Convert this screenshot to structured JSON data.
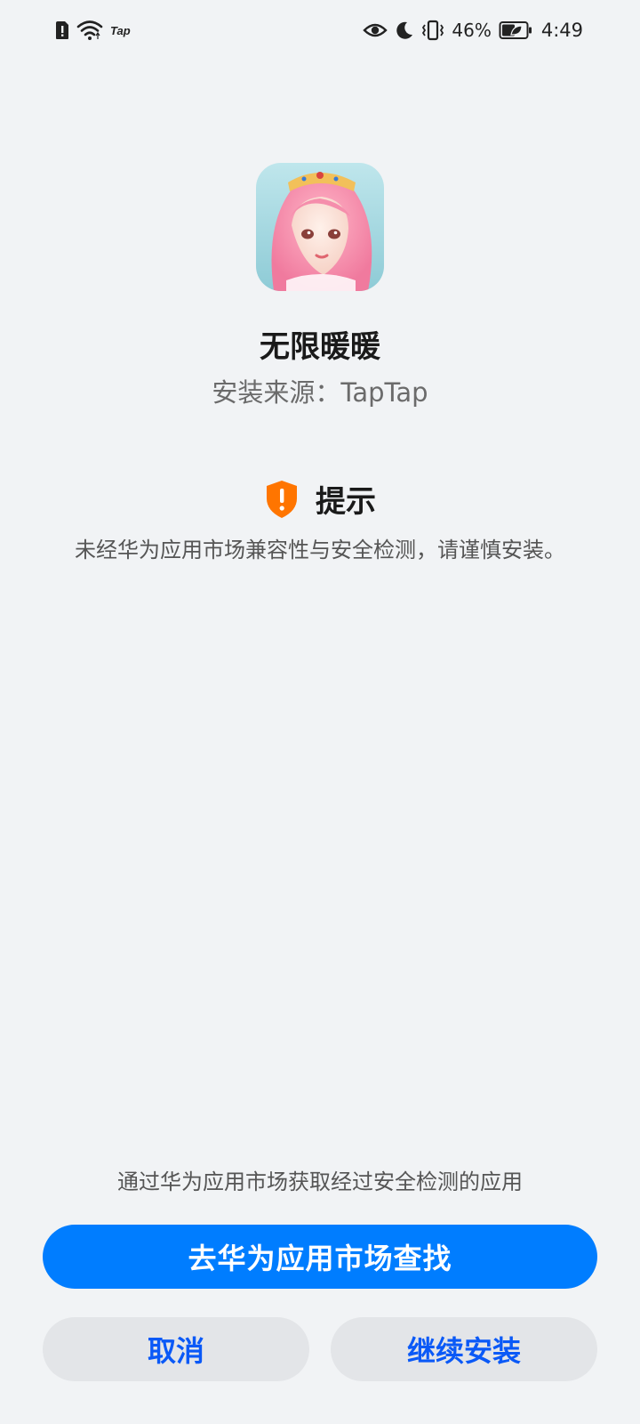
{
  "status_bar": {
    "left_icons": [
      "sim-alert-icon",
      "wifi-icon",
      "taptap-notification-icon"
    ],
    "tap_label": "Tap",
    "right_icons": [
      "eye-comfort-icon",
      "do-not-disturb-moon-icon",
      "vibrate-icon",
      "battery-saver-icon"
    ],
    "battery_percent": "46%",
    "time": "4:49"
  },
  "app": {
    "name": "无限暖暖",
    "install_source": "安装来源：TapTap"
  },
  "warning": {
    "title": "提示",
    "message": "未经华为应用市场兼容性与安全检测，请谨慎安装。",
    "icon": "shield-exclamation-icon",
    "icon_color": "#ff7500"
  },
  "bottom": {
    "market_hint": "通过华为应用市场获取经过安全检测的应用",
    "primary_button": "去华为应用市场查找",
    "cancel_button": "取消",
    "continue_button": "继续安装"
  },
  "colors": {
    "background": "#f1f3f5",
    "primary_button_bg": "#007dff",
    "secondary_button_bg": "#e3e5e8",
    "secondary_button_text": "#0a59f7"
  }
}
